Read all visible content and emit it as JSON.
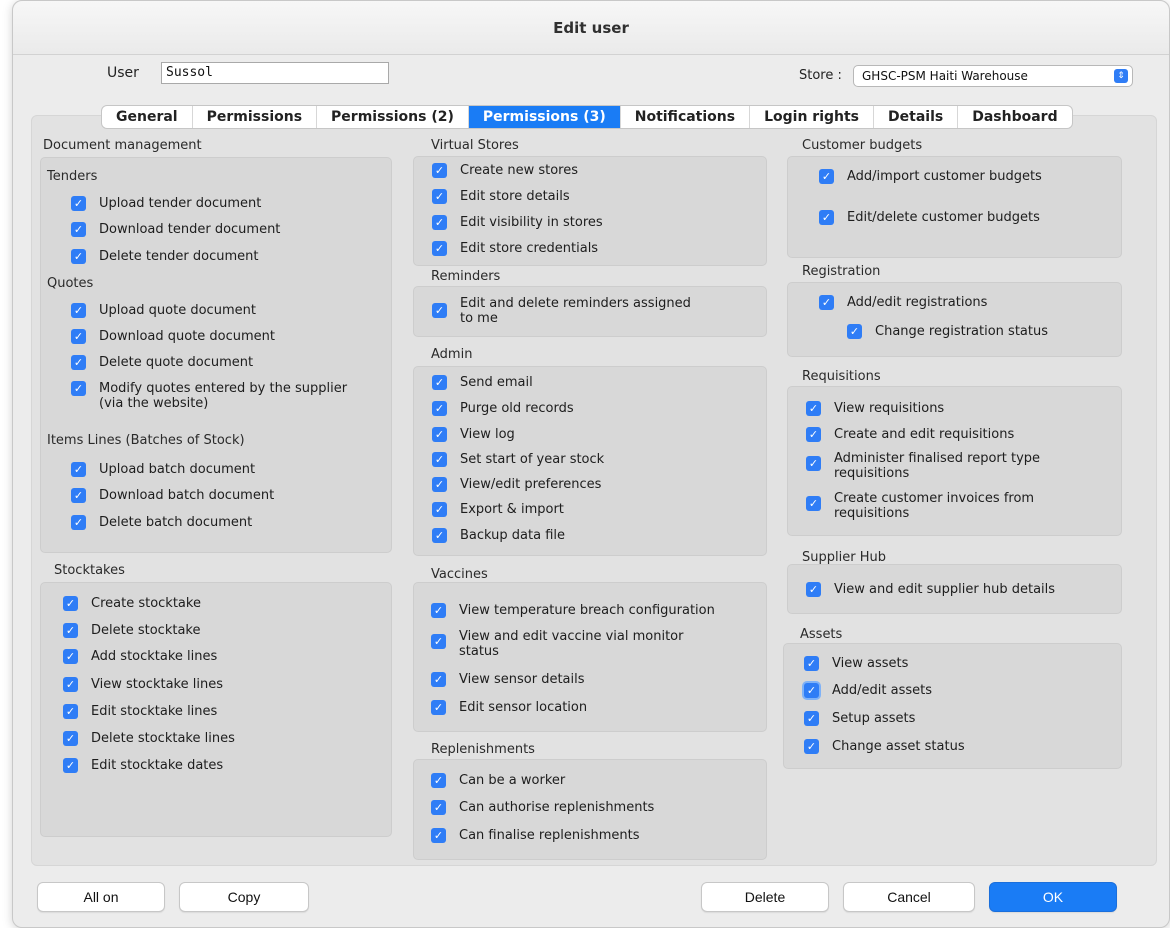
{
  "window": {
    "title": "Edit user"
  },
  "user": {
    "label": "User",
    "value": "Sussol"
  },
  "store": {
    "label": "Store :",
    "value": "GHSC-PSM Haiti Warehouse"
  },
  "tabs": [
    {
      "label": "General"
    },
    {
      "label": "Permissions"
    },
    {
      "label": "Permissions (2)"
    },
    {
      "label": "Permissions (3)",
      "active": true
    },
    {
      "label": "Notifications"
    },
    {
      "label": "Login rights"
    },
    {
      "label": "Details"
    },
    {
      "label": "Dashboard"
    }
  ],
  "document_management": {
    "title": "Document management",
    "tenders": {
      "title": "Tenders",
      "items": [
        "Upload tender document",
        "Download tender document",
        "Delete tender document"
      ]
    },
    "quotes": {
      "title": "Quotes",
      "items": [
        "Upload quote document",
        "Download quote document",
        "Delete quote document",
        "Modify quotes entered by the supplier",
        "(via the website)"
      ]
    },
    "items_lines": {
      "title": "Items Lines (Batches of Stock)",
      "items": [
        "Upload batch document",
        "Download batch document",
        "Delete batch document"
      ]
    }
  },
  "stocktakes": {
    "title": "Stocktakes",
    "items": [
      "Create stocktake",
      "Delete stocktake",
      "Add stocktake lines",
      "View stocktake lines",
      "Edit stocktake lines",
      "Delete stocktake lines",
      "Edit stocktake dates"
    ]
  },
  "virtual_stores": {
    "title": "Virtual Stores",
    "items": [
      "Create new stores",
      "Edit store details",
      "Edit visibility in stores",
      "Edit store credentials"
    ]
  },
  "reminders": {
    "title": "Reminders",
    "items": [
      "Edit and delete reminders assigned",
      "to me"
    ]
  },
  "admin": {
    "title": "Admin",
    "items": [
      "Send email",
      "Purge old records",
      "View log",
      "Set start of year stock",
      "View/edit preferences",
      "Export & import",
      "Backup data file"
    ]
  },
  "vaccines": {
    "title": "Vaccines",
    "items": [
      "View temperature breach configuration",
      "View and edit vaccine vial monitor",
      "status",
      "View sensor details",
      "Edit sensor location"
    ]
  },
  "replenishments": {
    "title": "Replenishments",
    "items": [
      "Can be a worker",
      "Can authorise replenishments",
      "Can finalise replenishments"
    ]
  },
  "customer_budgets": {
    "title": "Customer budgets",
    "items": [
      "Add/import customer budgets",
      "Edit/delete customer budgets"
    ]
  },
  "registration": {
    "title": "Registration",
    "items": [
      "Add/edit registrations",
      "Change registration status"
    ]
  },
  "requisitions": {
    "title": "Requisitions",
    "items": [
      "View requisitions",
      "Create and edit requisitions",
      "Administer finalised report type",
      "requisitions",
      "Create customer invoices from",
      "requisitions"
    ]
  },
  "supplier_hub": {
    "title": "Supplier Hub",
    "items": [
      "View and edit supplier hub details"
    ]
  },
  "assets": {
    "title": "Assets",
    "items": [
      "View assets",
      "Add/edit assets",
      "Setup assets",
      "Change asset status"
    ]
  },
  "buttons": {
    "all_on": "All on",
    "copy": "Copy",
    "delete": "Delete",
    "cancel": "Cancel",
    "ok": "OK"
  },
  "colors": {
    "accent": "#1a7cf5",
    "checkbox": "#2f7df6",
    "panel": "#d8d8d8",
    "background": "#e2e2e2"
  },
  "icons": {
    "checkbox_checked": "checkmark-icon",
    "popup_arrows": "up-down-chevron-icon"
  }
}
